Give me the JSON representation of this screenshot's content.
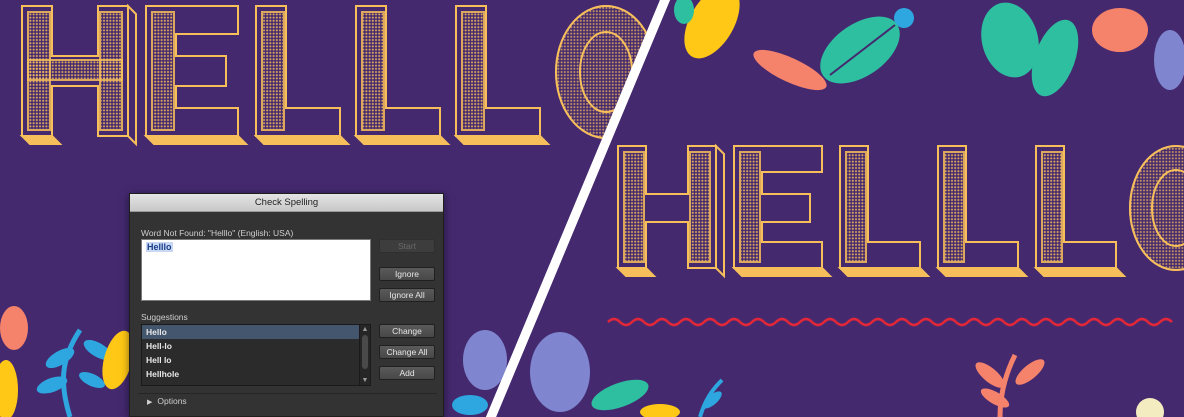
{
  "dialog": {
    "title": "Check Spelling",
    "not_found_label": "Word Not Found: \"Helllo\" (English: USA)",
    "word_value": "Helllo",
    "suggestions_label": "Suggestions",
    "suggestions": [
      "Hello",
      "Hell-lo",
      "Hell lo",
      "Hellhole"
    ],
    "selected_index": 0,
    "buttons": {
      "start": "Start",
      "ignore": "Ignore",
      "ignore_all": "Ignore All",
      "change": "Change",
      "change_all": "Change All",
      "add": "Add"
    },
    "options_label": "Options"
  },
  "artwork": {
    "left_word": "HELLLO",
    "right_word": "HELLLO",
    "colors": {
      "background": "#44296f",
      "letters": "#f7bf5c",
      "squiggle": "#e0283a",
      "teal": "#2dbfa0",
      "coral": "#f5826a",
      "yellow": "#ffc816",
      "blue": "#2ea7e0",
      "lilac": "#7f85cf"
    }
  }
}
